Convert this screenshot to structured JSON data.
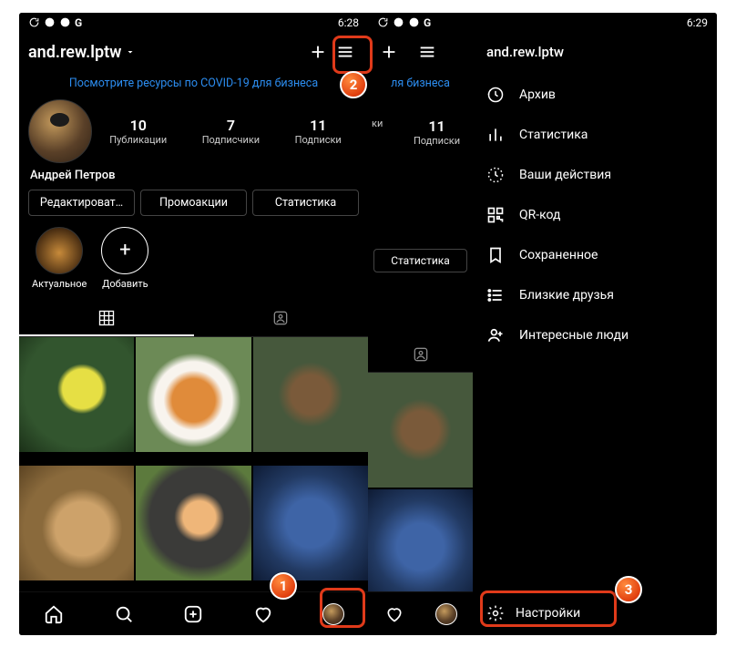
{
  "left": {
    "status": {
      "time": "6:28"
    },
    "username": "and.rew.lptw",
    "covid_banner": "Посмотрите ресурсы по COVID-19 для бизнеса",
    "stats": {
      "posts": {
        "n": "10",
        "l": "Публикации"
      },
      "followers": {
        "n": "7",
        "l": "Подписчики"
      },
      "following": {
        "n": "11",
        "l": "Подписки"
      }
    },
    "display_name": "Андрей Петров",
    "buttons": {
      "edit": "Редактироват…",
      "promo": "Промоакции",
      "stats": "Статистика"
    },
    "highlights": {
      "actual": "Актуальное",
      "add": "Добавить"
    }
  },
  "right": {
    "status": {
      "time": "6:29"
    },
    "username": "and.rew.lptw",
    "covid_partial": "ля бизнеса",
    "stats_partial": {
      "left_cut": {
        "n": "",
        "l": "ки"
      },
      "following": {
        "n": "11",
        "l": "Подписки"
      }
    },
    "strip_btn": "Статистика",
    "menu": {
      "archive": "Архив",
      "stats": "Статистика",
      "activity": "Ваши действия",
      "qr": "QR-код",
      "saved": "Сохраненное",
      "close": "Близкие друзья",
      "discover": "Интересные люди",
      "settings": "Настройки"
    }
  },
  "badges": {
    "b1": "1",
    "b2": "2",
    "b3": "3"
  }
}
